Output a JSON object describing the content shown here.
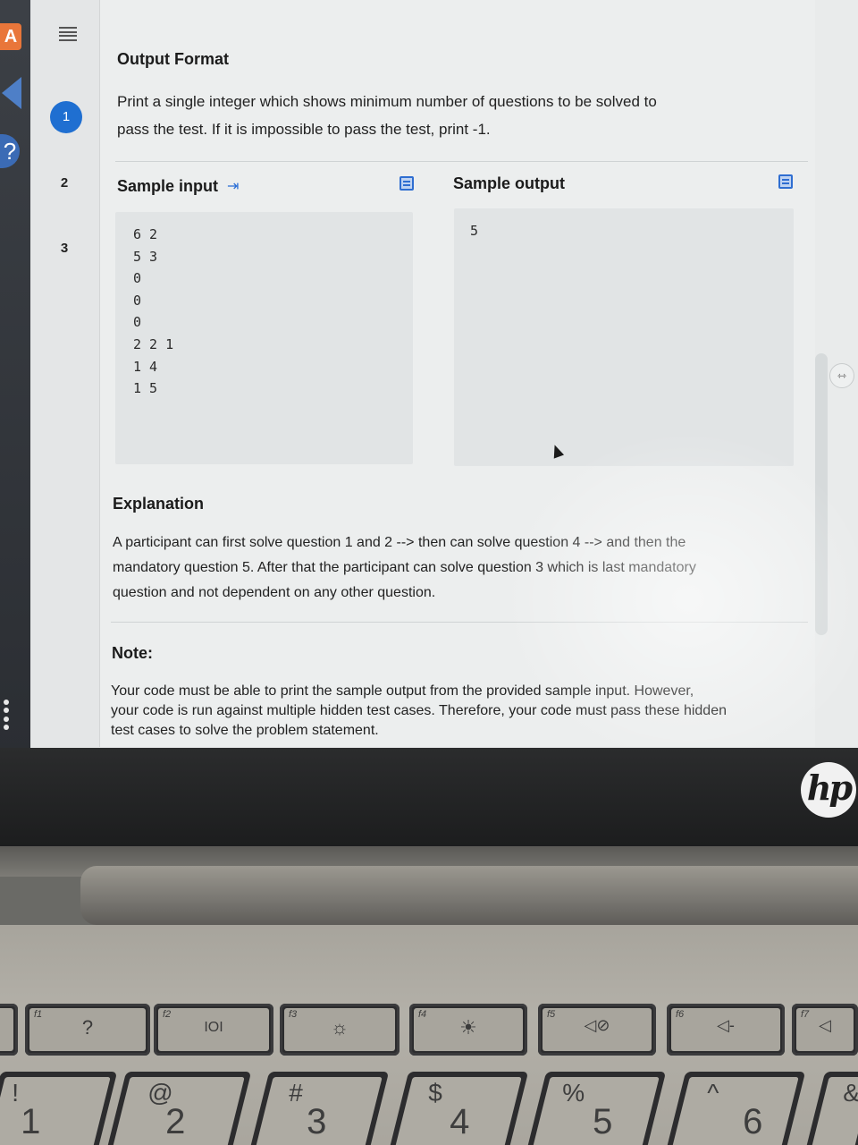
{
  "nav": {
    "question_numbers": [
      "1",
      "2",
      "3"
    ],
    "active_question": "1"
  },
  "output_format": {
    "title": "Output Format",
    "lines": [
      "Print a single integer which shows minimum number of questions to be solved to",
      "pass the test. If it is impossible to pass the test, print -1."
    ]
  },
  "samples": {
    "input_label": "Sample input",
    "output_label": "Sample output",
    "input_lines": [
      "6 2",
      "5 3",
      "0",
      "0",
      "0",
      "2 2 1",
      "1 4",
      "1 5"
    ],
    "output_lines": [
      "5"
    ]
  },
  "explanation": {
    "title": "Explanation",
    "lines": [
      "A participant can first solve question 1 and 2 --> then can solve question 4 --> and then the",
      "mandatory question 5. After that the participant can solve question 3 which is last mandatory",
      "question and not dependent on any other question."
    ]
  },
  "note": {
    "title": "Note:",
    "lines": [
      "Your code must be able to print the sample output from the provided sample input. However,",
      "your code is run against multiple hidden test cases. Therefore, your code must pass these hidden",
      "test cases to solve the problem statement."
    ]
  },
  "logo": {
    "text": "hp"
  },
  "keyboard": {
    "fn_keys": [
      {
        "fn": "f1",
        "glyph": "?"
      },
      {
        "fn": "f2",
        "glyph": "IOI"
      },
      {
        "fn": "f3",
        "glyph": "☼"
      },
      {
        "fn": "f4",
        "glyph": "☀"
      },
      {
        "fn": "f5",
        "glyph": "◁⊘"
      },
      {
        "fn": "f6",
        "glyph": "◁-"
      },
      {
        "fn": "f7",
        "glyph": "◁"
      }
    ],
    "number_keys": [
      {
        "symbol": "!",
        "digit": "1"
      },
      {
        "symbol": "@",
        "digit": "2"
      },
      {
        "symbol": "#",
        "digit": "3"
      },
      {
        "symbol": "$",
        "digit": "4"
      },
      {
        "symbol": "%",
        "digit": "5"
      },
      {
        "symbol": "^",
        "digit": "6"
      },
      {
        "symbol": "&",
        "digit": ""
      }
    ]
  }
}
